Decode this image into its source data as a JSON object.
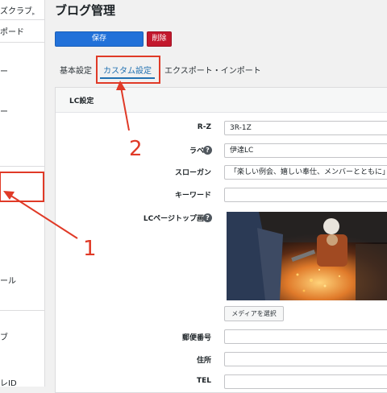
{
  "sidebar": {
    "items": [
      {
        "label": "ズクラブ"
      },
      {
        "label": "ポード"
      },
      {
        "label": "ール"
      },
      {
        "label": "ブ"
      },
      {
        "label": "レID"
      }
    ]
  },
  "header": {
    "title": "ブログ管理"
  },
  "toolbar": {
    "save_label": "保存",
    "delete_label": "削除"
  },
  "tabs": [
    {
      "label": "基本設定",
      "active": false
    },
    {
      "label": "カスタム設定",
      "active": true
    },
    {
      "label": "エクスポート・インポート",
      "active": false
    }
  ],
  "section": {
    "title": "LC設定"
  },
  "fields": {
    "rz": {
      "label": "R-Z",
      "value": "3R-1Z"
    },
    "label": {
      "label": "ラベル",
      "value": "伊達LC"
    },
    "slogan": {
      "label": "スローガン",
      "value": "「楽しい例会、嬉しい奉仕、メンバーとともに」"
    },
    "keyword": {
      "label": "キーワード",
      "value": ""
    },
    "top_image": {
      "label": "LCページトップ画像"
    },
    "postal": {
      "label": "郵便番号",
      "value": ""
    },
    "address": {
      "label": "住所",
      "value": ""
    },
    "tel": {
      "label": "TEL",
      "value": ""
    }
  },
  "media": {
    "button_label": "メディアを選択"
  },
  "annotations": {
    "n1": "1",
    "n2": "2"
  },
  "colors": {
    "primary": "#2271d9",
    "danger": "#c3182d",
    "annotation": "#e03a27",
    "tab_active": "#2271b1"
  }
}
